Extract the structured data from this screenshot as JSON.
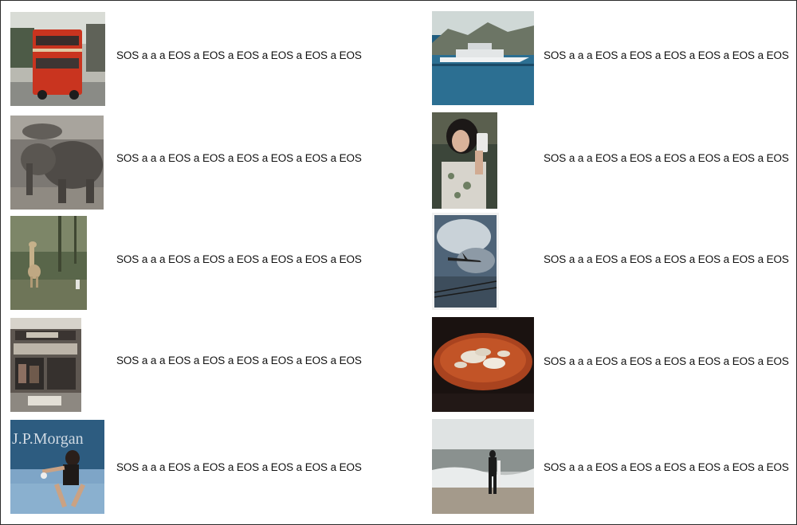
{
  "items": [
    {
      "image": "double-decker-bus-photo",
      "caption": "SOS a a a EOS a EOS a EOS a EOS a EOS a EOS"
    },
    {
      "image": "elephants-photo",
      "caption": "SOS a a a EOS a EOS a EOS a EOS a EOS a EOS"
    },
    {
      "image": "giraffe-photo",
      "caption": "SOS a a a EOS a EOS a EOS a EOS a EOS a EOS"
    },
    {
      "image": "storefront-photo",
      "caption": "SOS a a a EOS a EOS a EOS a EOS a EOS a EOS"
    },
    {
      "image": "tennis-player-photo",
      "caption": "SOS a a a EOS a EOS a EOS a EOS a EOS a EOS",
      "sign_text": "J.P.Morgan"
    },
    {
      "image": "yacht-harbor-photo",
      "caption": "SOS a a a EOS a EOS a EOS a EOS a EOS a EOS"
    },
    {
      "image": "woman-phone-photo",
      "caption": "SOS a a a EOS a EOS a EOS a EOS a EOS a EOS"
    },
    {
      "image": "airplane-sky-photo",
      "caption": "SOS a a a EOS a EOS a EOS a EOS a EOS a EOS"
    },
    {
      "image": "pizza-photo",
      "caption": "SOS a a a EOS a EOS a EOS a EOS a EOS a EOS"
    },
    {
      "image": "surfer-beach-photo",
      "caption": "SOS a a a EOS a EOS a EOS a EOS a EOS a EOS"
    }
  ]
}
